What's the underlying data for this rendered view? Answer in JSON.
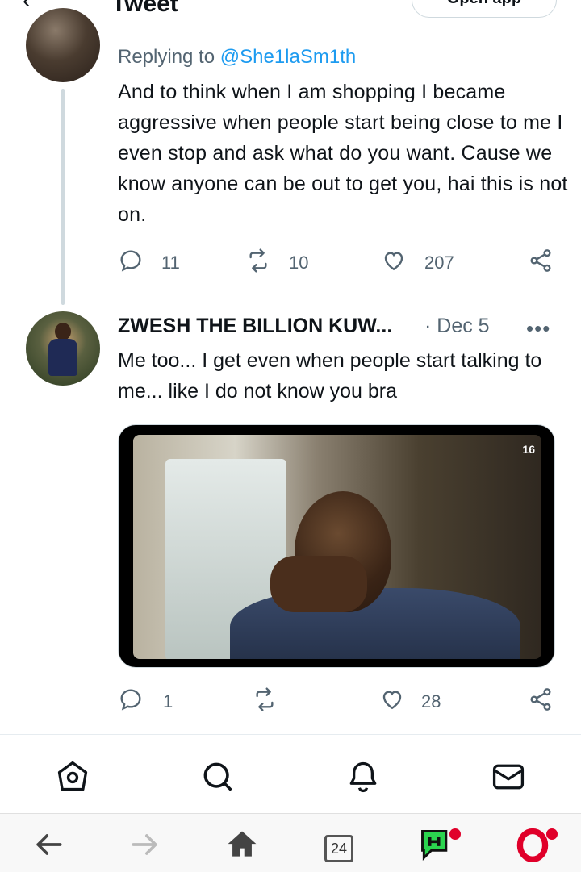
{
  "header": {
    "back_icon": "back-arrow-icon",
    "title": "Tweet",
    "open_app_label": "Open app"
  },
  "tweet1": {
    "replying_prefix": "Replying to",
    "replying_handle": "@She1laSm1th",
    "text": "And to think when I am shopping I became aggressive when people start being close to me I even stop and ask what do you want. Cause we know anyone can be out to get you, hai this is not on.",
    "replies": "11",
    "retweets": "10",
    "likes": "207"
  },
  "tweet2": {
    "name": "ZWESH THE BILLION KUW...",
    "date": "· Dec 5",
    "more_label": "•••",
    "text": "Me too... I get even when people start talking to me... like I do not know you bra",
    "media_badge": "16",
    "replies": "1",
    "retweets": "",
    "likes": "28"
  },
  "twitter_nav": {
    "items": [
      "home-icon",
      "search-icon",
      "notifications-icon",
      "messages-icon"
    ]
  },
  "browser_bar": {
    "tabs_count": "24",
    "items": [
      "back-arrow-icon",
      "forward-arrow-icon",
      "home-icon",
      "tabs-icon",
      "news-app-icon",
      "opera-icon"
    ]
  },
  "colors": {
    "accent": "#1d9bf0",
    "secondary_text": "#536471",
    "divider": "#e6ecf0",
    "notification_dot": "#e0002a"
  }
}
